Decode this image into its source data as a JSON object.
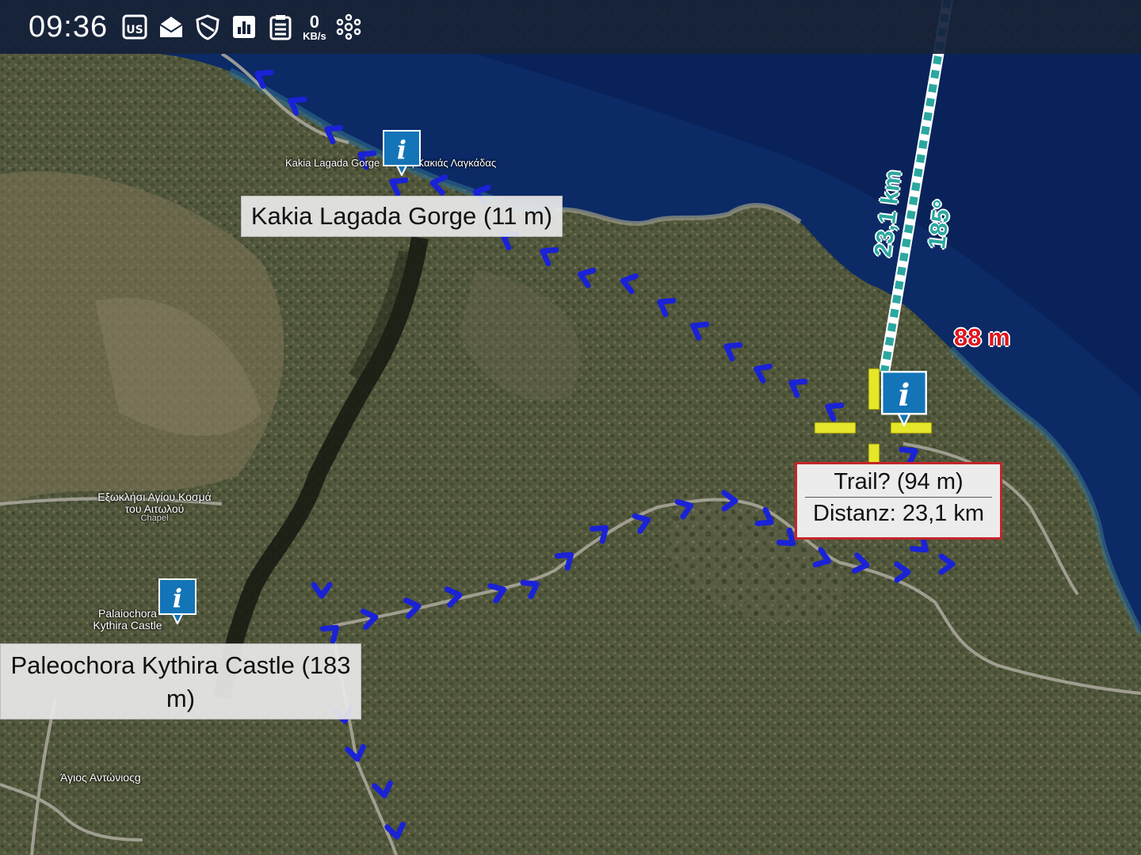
{
  "status_bar": {
    "time": "09:36",
    "net_speed_value": "0",
    "net_speed_unit": "KB/s",
    "icons": [
      "photo-icon",
      "mail-icon",
      "shield-icon",
      "chart-icon",
      "clipboard-icon",
      "network-speed",
      "molecule-icon"
    ]
  },
  "waypoints": {
    "kakia": {
      "label": "Kakia Lagada Gorge (11 m)"
    },
    "paleochora": {
      "label": "Paleochora Kythira Castle (183 m)"
    }
  },
  "popup": {
    "line1": "Trail? (94 m)",
    "line2": "Distanz: 23,1 km"
  },
  "measure": {
    "distance": "23,1 km",
    "bearing": "185°",
    "altitude": "88 m"
  },
  "map_places": {
    "chapel_name": "Εξωκλήσι Αγίου Κοσμά του Αιτωλού",
    "chapel_type": "Chapel",
    "paleo_name": "Palaiochora Kythira Castle",
    "antonios": "Άγιος Αντώνιοςg",
    "kakia_place": "Kakia Lagada Gorge / Λιμνη Κακιάς Λαγκάδας"
  },
  "colors": {
    "track": "#1a22d6",
    "measure": "#2aa8a0",
    "crosshair": "#e6e62a",
    "pin": "#1374b8",
    "sea": "#0b2a66"
  }
}
